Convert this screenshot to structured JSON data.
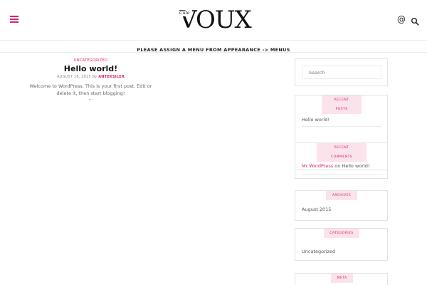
{
  "header": {
    "logo_main": "VOUX",
    "logo_small": "Cute",
    "at_symbol": "@",
    "icons": [
      "menu-icon",
      "at-icon",
      "search-icon"
    ],
    "accent_color": "#d6246e"
  },
  "menubar": {
    "notice": "PLEASE ASSIGN A MENU FROM APPEARANCE -> MENUS"
  },
  "post": {
    "category": "UNCATEGORIZED",
    "title": "Hello world!",
    "date": "AUGUST 18, 2015",
    "by": "By",
    "author": "ANTEKSILER",
    "excerpt": "Welcome to WordPress. This is your first post. Edit or delete it, then start blogging!",
    "more": "..."
  },
  "sidebar": {
    "search_placeholder": "Search",
    "recent_posts": {
      "tab_line1": "RECENT",
      "tab_line2": "POSTS",
      "item": "Hello world!"
    },
    "recent_comments": {
      "tab_line1": "RECENT",
      "tab_line2": "COMMENTS",
      "author": "Mr WordPress",
      "on": "on",
      "post": "Hello world!"
    },
    "archives": {
      "tab": "ARCHIVES",
      "item": "August 2015"
    },
    "categories": {
      "tab": "CATEGORIES",
      "item": "Uncategorized"
    },
    "meta": {
      "tab": "META"
    }
  }
}
